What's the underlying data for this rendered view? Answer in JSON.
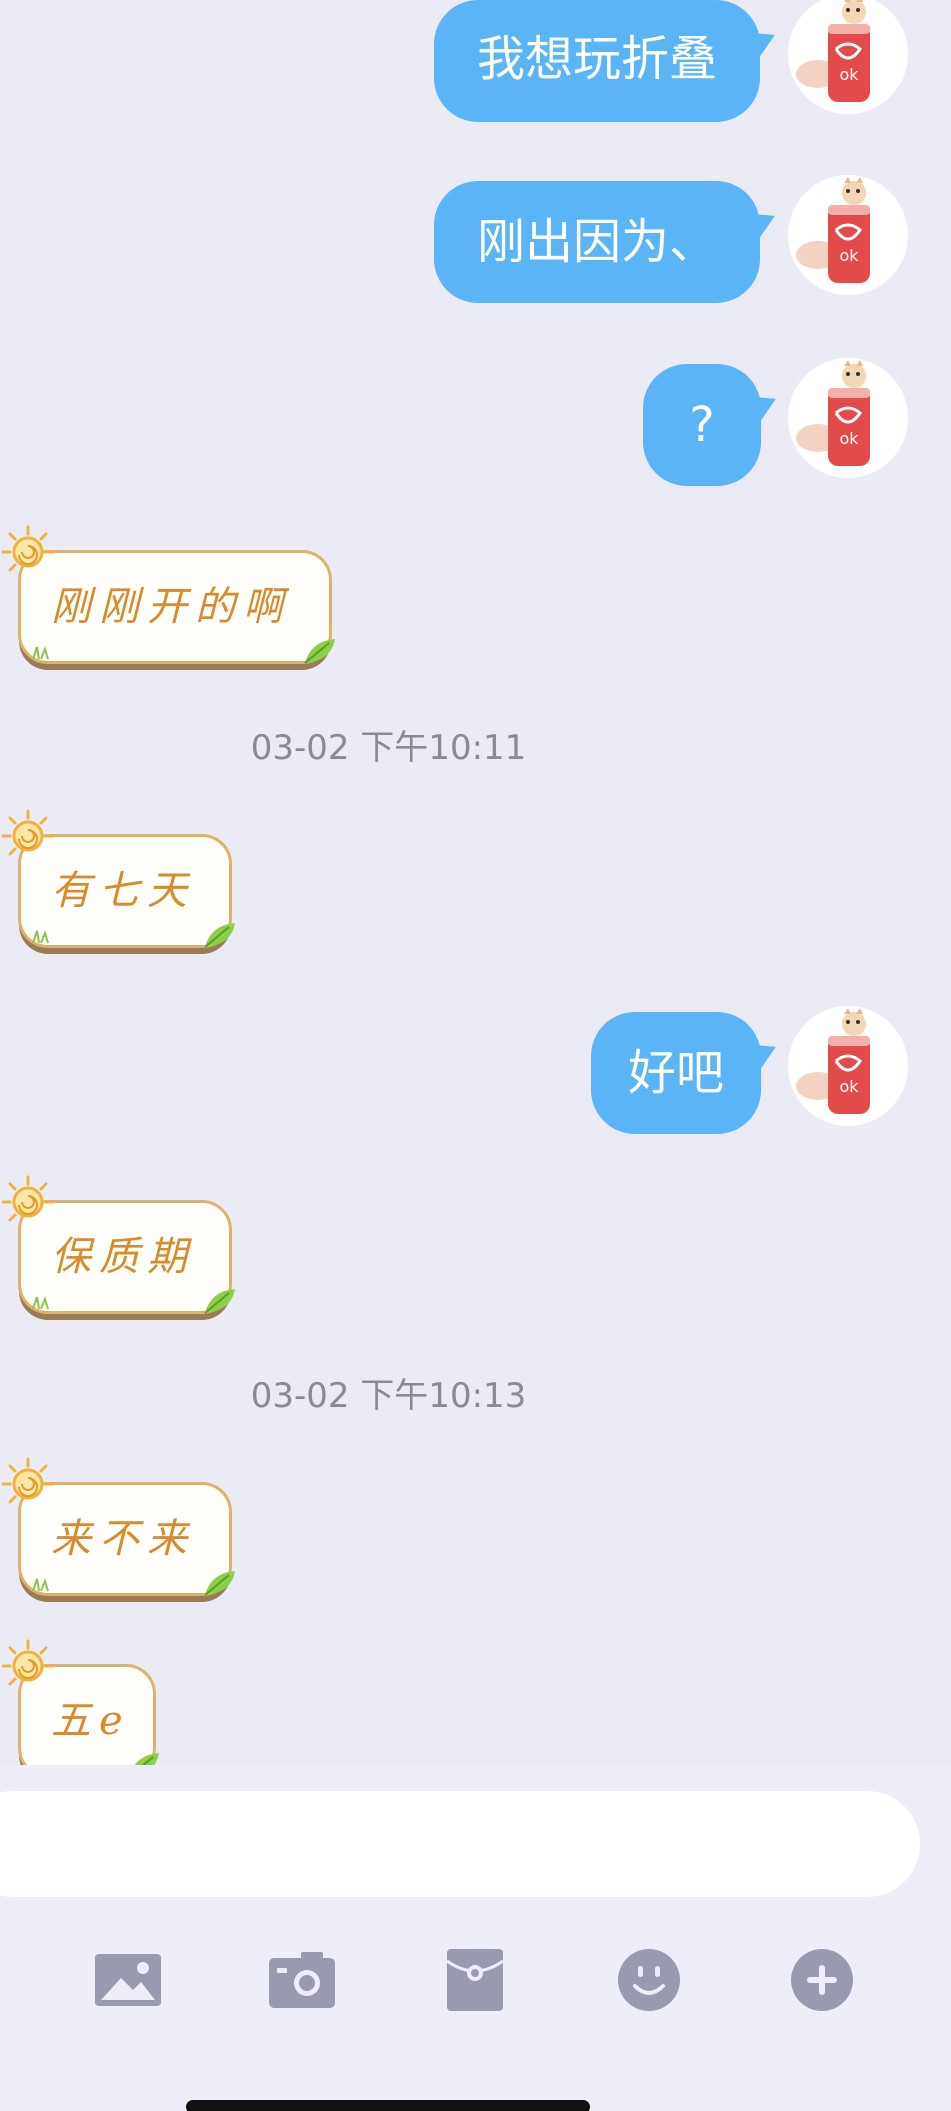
{
  "colors": {
    "background": "#ebebf5",
    "outgoing_bubble": "#5ab4f6",
    "incoming_text": "#d98a2b",
    "timestamp": "#8a8a96",
    "toolbar_icon": "#999aaf"
  },
  "messages": [
    {
      "direction": "out",
      "text": "我想玩折叠"
    },
    {
      "direction": "out",
      "text": "刚出因为、"
    },
    {
      "direction": "out",
      "text": "?"
    },
    {
      "direction": "in",
      "text": "刚刚开的啊"
    },
    {
      "type": "timestamp",
      "text": "03-02 下午10:11"
    },
    {
      "direction": "in",
      "text": "有七天"
    },
    {
      "direction": "out",
      "text": "好吧"
    },
    {
      "direction": "in",
      "text": "保质期"
    },
    {
      "type": "timestamp",
      "text": "03-02 下午10:13"
    },
    {
      "direction": "in",
      "text": "来不来"
    },
    {
      "direction": "in",
      "text": "五e"
    }
  ],
  "input": {
    "value": "",
    "placeholder": ""
  },
  "toolbar": [
    {
      "icon": "image-icon"
    },
    {
      "icon": "camera-icon"
    },
    {
      "icon": "red-packet-icon"
    },
    {
      "icon": "emoji-icon"
    },
    {
      "icon": "plus-icon"
    }
  ]
}
